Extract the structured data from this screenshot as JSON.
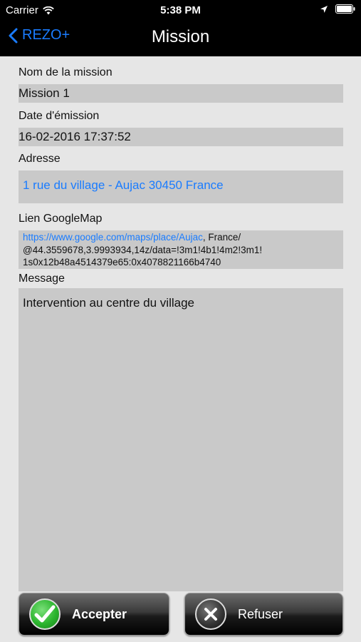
{
  "status_bar": {
    "carrier": "Carrier",
    "time": "5:38 PM"
  },
  "nav": {
    "back_label": "REZO+",
    "title": "Mission"
  },
  "form": {
    "name_label": "Nom de la mission",
    "name_value": "Mission 1",
    "date_label": "Date d'émission",
    "date_value": "16-02-2016 17:37:52",
    "address_label": "Adresse",
    "address_value": "1 rue du village - Aujac 30450 France",
    "gmap_label": "Lien GoogleMap",
    "gmap_url": "https://www.google.com/maps/place/Aujac",
    "gmap_rest_1": ", France/",
    "gmap_line_2": "@44.3559678,3.9993934,14z/data=!3m1!4b1!4m2!3m1!",
    "gmap_line_3": "1s0x12b48a4514379e65:0x4078821166b4740",
    "message_label": "Message",
    "message_value": "Intervention au centre du village"
  },
  "actions": {
    "accept_label": "Accepter",
    "refuse_label": "Refuser"
  },
  "colors": {
    "link": "#1a7cff",
    "accept_green": "#2bb52e",
    "field_bg": "#c9c9c9",
    "page_bg": "#e6e6e6"
  }
}
